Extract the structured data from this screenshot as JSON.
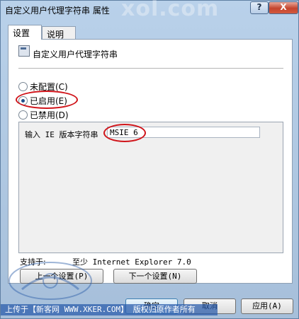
{
  "window": {
    "title": "自定义用户代理字符串 属性",
    "watermark": "xol.com",
    "help_label": "?",
    "close_label": "X"
  },
  "tabs": [
    {
      "label": "设置"
    },
    {
      "label": "说明"
    }
  ],
  "policy": {
    "name": "自定义用户代理字符串"
  },
  "radios": [
    {
      "label": "未配置(C)",
      "checked": false
    },
    {
      "label": "已启用(E)",
      "checked": true
    },
    {
      "label": "已禁用(D)",
      "checked": false
    }
  ],
  "options": {
    "label": "输入 IE 版本字符串",
    "value": "MSIE 6"
  },
  "supported": {
    "label": "支持于:",
    "value": "至少 Internet Explorer 7.0"
  },
  "nav": {
    "prev_label": "上一个设置(P)",
    "next_label": "下一个设置(N)"
  },
  "dialog_buttons": {
    "ok": "确定",
    "cancel": "取消",
    "apply": "应用(A)"
  },
  "footer": {
    "text": "上传于【新客网 WWW.XKER.COM】 版权归原作者所有"
  },
  "colors": {
    "highlight": "#d0141a",
    "footer_bg": "#285aaa"
  }
}
